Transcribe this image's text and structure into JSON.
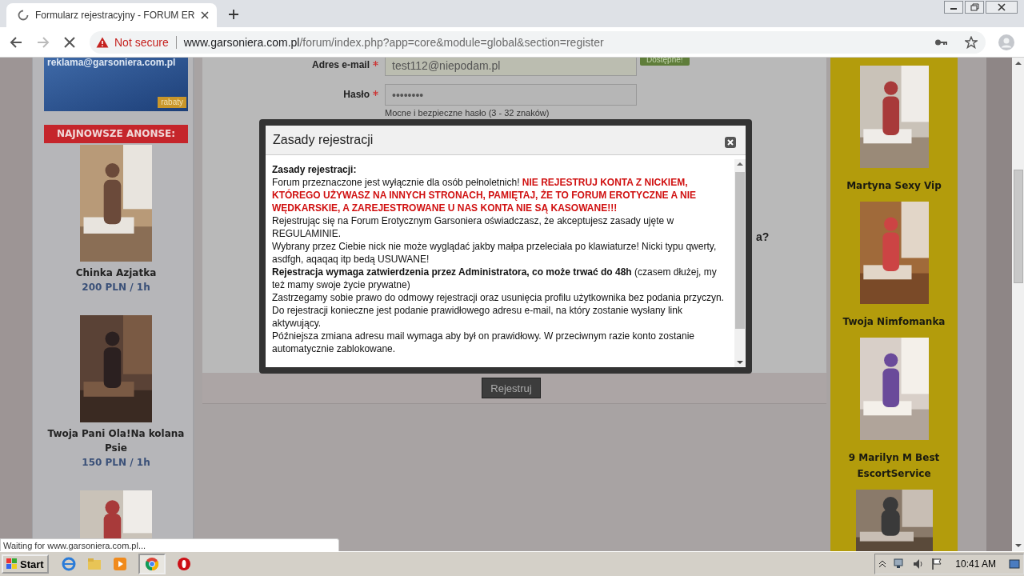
{
  "browser": {
    "tab": {
      "title": "Formularz rejestracyjny - FORUM ER",
      "loading": true
    },
    "address": {
      "warning": "Not secure",
      "host": "www.garsoniera.com.pl",
      "path": "/forum/index.php?app=core&module=global&section=register"
    },
    "status": "Waiting for www.garsoniera.com.pl..."
  },
  "left_sidebar": {
    "banner": {
      "email": "reklama@garsoniera.com.pl",
      "badge": "rabaty"
    },
    "heading": "NAJNOWSZE ANONSE:",
    "ads": [
      {
        "name": "Chinka Azjatka",
        "price": "200 PLN / 1h"
      },
      {
        "name": "Twoja Pani Ola!Na kolana Psie",
        "price": "150 PLN / 1h"
      },
      {
        "kind": "picture"
      }
    ]
  },
  "form": {
    "fields": [
      {
        "label": "Adres e-mail",
        "required": true,
        "value": "test112@niepodam.pl",
        "badge": "Dostępne!"
      },
      {
        "label": "Hasło",
        "required": true,
        "value": "••••••••",
        "hint": "Mocne i bezpieczne hasło (3 - 32 znaków)"
      }
    ],
    "cut_text": "a?",
    "submit": "Rejestruj"
  },
  "right_sidebar": {
    "ads": [
      {
        "name": "Martyna Sexy Vip"
      },
      {
        "name": "Twoja Nimfomanka"
      },
      {
        "name": "9 Marilyn M Best EscortService"
      },
      {
        "kind": "picture"
      }
    ]
  },
  "modal": {
    "title": "Zasady rejestracji",
    "heading": "Zasady rejestracji:",
    "paragraphs": [
      [
        {
          "kind": "plain",
          "text": "Forum przeznaczone jest wyłącznie dla osób pełnoletnich! "
        },
        {
          "kind": "warning",
          "text": "NIE REJESTRUJ KONTA Z NICKIEM, KTÓREGO UŻYWASZ NA INNYCH STRONACH, PAMIĘTAJ, ŻE TO FORUM EROTYCZNE A NIE WĘDKARSKIE, A ZAREJESTROWANE U NAS KONTA NIE SĄ KASOWANE!!!"
        }
      ],
      [
        {
          "kind": "plain",
          "text": "Rejestrując się na Forum Erotycznym Garsoniera oświadczasz, że akceptujesz zasady ujęte w REGULAMINIE."
        }
      ],
      [
        {
          "kind": "plain",
          "text": "Wybrany przez Ciebie nick nie może wyglądać jakby małpa przeleciała po klawiaturze! Nicki typu qwerty, asdfgh, aqaqaq itp bedą USUWANE!"
        }
      ],
      [
        {
          "kind": "bold",
          "text": "Rejestracja wymaga zatwierdzenia przez Administratora, co może trwać do 48h"
        },
        {
          "kind": "plain",
          "text": " (czasem dłużej, my też mamy swoje życie prywatne)"
        }
      ],
      [
        {
          "kind": "plain",
          "text": "Zastrzegamy sobie prawo do odmowy rejestracji oraz usunięcia profilu użytkownika bez podania przyczyn."
        }
      ],
      [
        {
          "kind": "plain",
          "text": "Do rejestracji konieczne jest podanie prawidłowego adresu e-mail, na który zostanie wysłany link aktywujący."
        }
      ],
      [
        {
          "kind": "plain",
          "text": "Późniejsza zmiana adresu mail wymaga aby był on prawidłowy. W przeciwnym razie konto zostanie automatycznie zablokowane."
        }
      ]
    ]
  },
  "taskbar": {
    "start": "Start",
    "clock": "10:41 AM"
  }
}
